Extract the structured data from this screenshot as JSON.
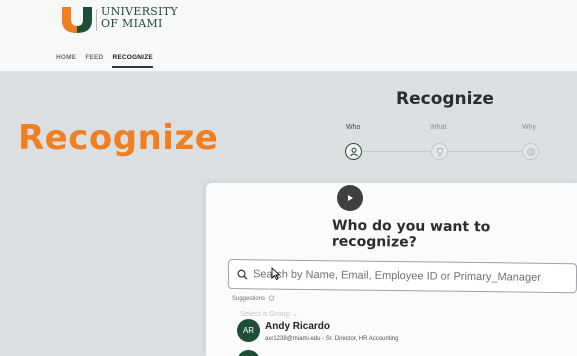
{
  "brand": {
    "line1": "UNIVERSITY",
    "line2": "OF MIAMI",
    "u_orange": "#f07f22",
    "u_green": "#1f4d35"
  },
  "nav": {
    "items": [
      {
        "label": "HOME"
      },
      {
        "label": "FEED"
      },
      {
        "label": "RECOGNIZE"
      }
    ]
  },
  "hero": {
    "title": "Recognize",
    "color": "#f07f22"
  },
  "panel": {
    "heading": "Recognize",
    "steps": [
      {
        "label": "Who",
        "icon": "user-icon"
      },
      {
        "label": "What",
        "icon": "trophy-icon"
      },
      {
        "label": "Why",
        "icon": "badge-icon"
      }
    ],
    "question": "Who do you want to recognize?",
    "search": {
      "placeholder": "Search by Name, Email, Employee ID or Primary_Manager"
    },
    "suggestions_label": "Suggestions",
    "select_group": "Select a Group",
    "suggestion": {
      "initials": "AR",
      "name": "Andy Ricardo",
      "detail": "axr1238@miami.edu - Sr. Director, HR Accounting"
    }
  }
}
